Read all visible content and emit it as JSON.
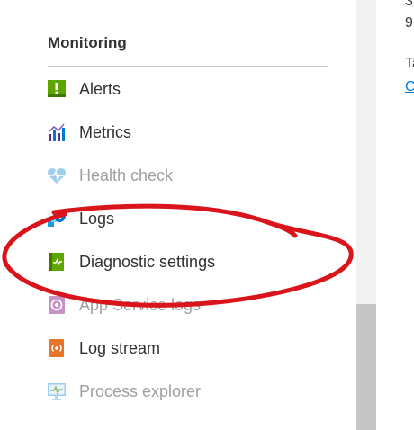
{
  "monitoring": {
    "title": "Monitoring",
    "items": [
      {
        "label": "Alerts",
        "icon": "alert-icon"
      },
      {
        "label": "Metrics",
        "icon": "metrics-icon"
      },
      {
        "label": "Health check",
        "icon": "health-check-icon"
      },
      {
        "label": "Logs",
        "icon": "logs-icon"
      },
      {
        "label": "Diagnostic settings",
        "icon": "diagnostic-settings-icon"
      },
      {
        "label": "App Service logs",
        "icon": "app-service-logs-icon"
      },
      {
        "label": "Log stream",
        "icon": "log-stream-icon"
      },
      {
        "label": "Process explorer",
        "icon": "process-explorer-icon"
      }
    ]
  },
  "right_pane": {
    "line1": "3",
    "line2": "9",
    "line3": "Ta",
    "link": "C"
  },
  "colors": {
    "annotation": "#d9141a",
    "link": "#0078d4"
  }
}
